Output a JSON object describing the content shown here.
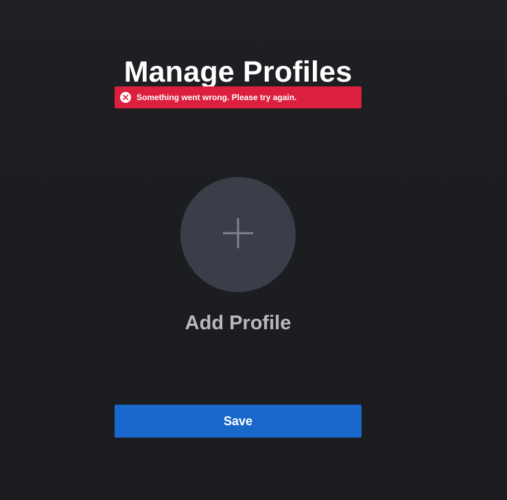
{
  "page": {
    "title": "Manage Profiles"
  },
  "alert": {
    "message": "Something went wrong. Please try again.",
    "icon": "error-circle-x-icon",
    "color": "#dc1f3e"
  },
  "add_profile": {
    "label": "Add Profile",
    "icon": "plus-icon",
    "circle_color": "#393e48"
  },
  "actions": {
    "save_label": "Save",
    "save_color": "#1a68cc"
  },
  "theme": {
    "background": "#1c1d21",
    "text": "#ffffff",
    "muted_text": "#b7b9be"
  }
}
